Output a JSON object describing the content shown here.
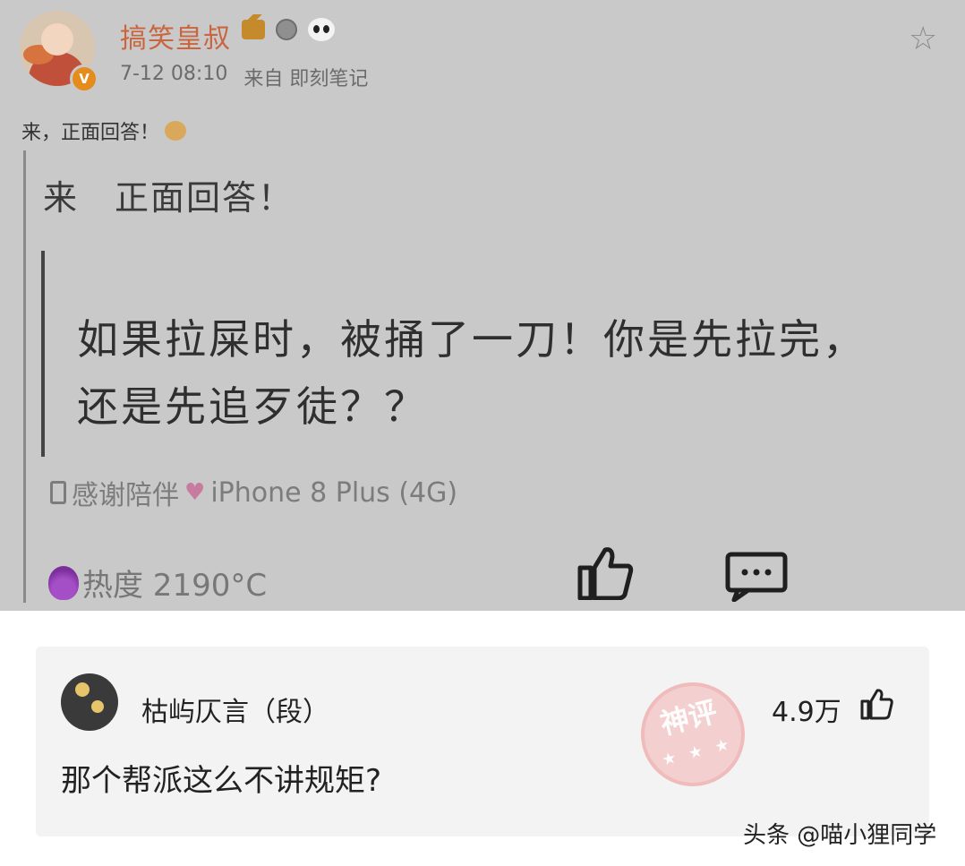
{
  "post": {
    "username": "搞笑皇叔",
    "verified_mark": "V",
    "time": "7-12 08:10",
    "source": "来自 即刻笔记",
    "text": "来，正面回答！",
    "repost_text": "来　正面回答！",
    "quote": "如果拉屎时，被捅了一刀！你是先拉完，还是先追歹徒？？",
    "device": "感谢陪伴",
    "device_model": "iPhone 8 Plus (4G)",
    "heat_label": "热度 2190°C",
    "icons": {
      "star": "star-icon",
      "like": "thumbs-up-icon",
      "comment": "comment-icon",
      "flame": "flame-icon",
      "phone": "phone-icon"
    }
  },
  "comment": {
    "username": "枯屿仄言（段）",
    "likes": "4.9万",
    "text": "那个帮派这么不讲规矩?",
    "stamp": "神评",
    "stamp_dots": "★ ★ ★"
  },
  "watermark": "头条 @喵小狸同学",
  "colors": {
    "panel_bg": "#c9c9c9",
    "username": "#c9653f",
    "card_bg": "#f3f3f3",
    "stamp": "#f4c9c9"
  }
}
